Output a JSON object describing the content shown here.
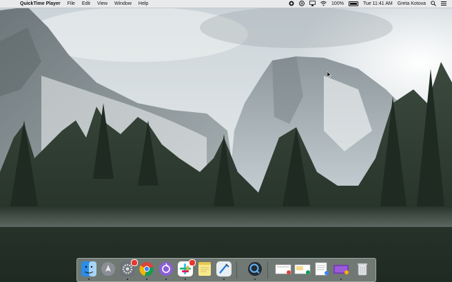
{
  "menubar": {
    "apple_glyph": "",
    "app_name": "QuickTime Player",
    "menus": [
      "File",
      "Edit",
      "View",
      "Window",
      "Help"
    ],
    "status": {
      "battery": "100%",
      "clock": "Tue 11:41 AM",
      "user": "Greta Kotova"
    }
  },
  "icons": {
    "menubar_right": [
      "record-icon",
      "pause-icon",
      "airplay-icon",
      "wifi-icon",
      "battery-icon",
      "search-icon",
      "notification-center-icon"
    ],
    "dock": [
      "finder-icon",
      "launchpad-icon",
      "system-preferences-icon",
      "chrome-icon",
      "podcast-icon",
      "slack-icon",
      "notes-icon",
      "xcode-icon",
      "quicktime-icon",
      "document-thumbnail-icon",
      "document-thumbnail-icon",
      "document-thumbnail-icon",
      "document-thumbnail-icon",
      "screenshot-thumbnail-icon",
      "trash-icon"
    ]
  },
  "colors": {
    "menubar_bg": "#ececee",
    "badge": "#e8372c"
  }
}
